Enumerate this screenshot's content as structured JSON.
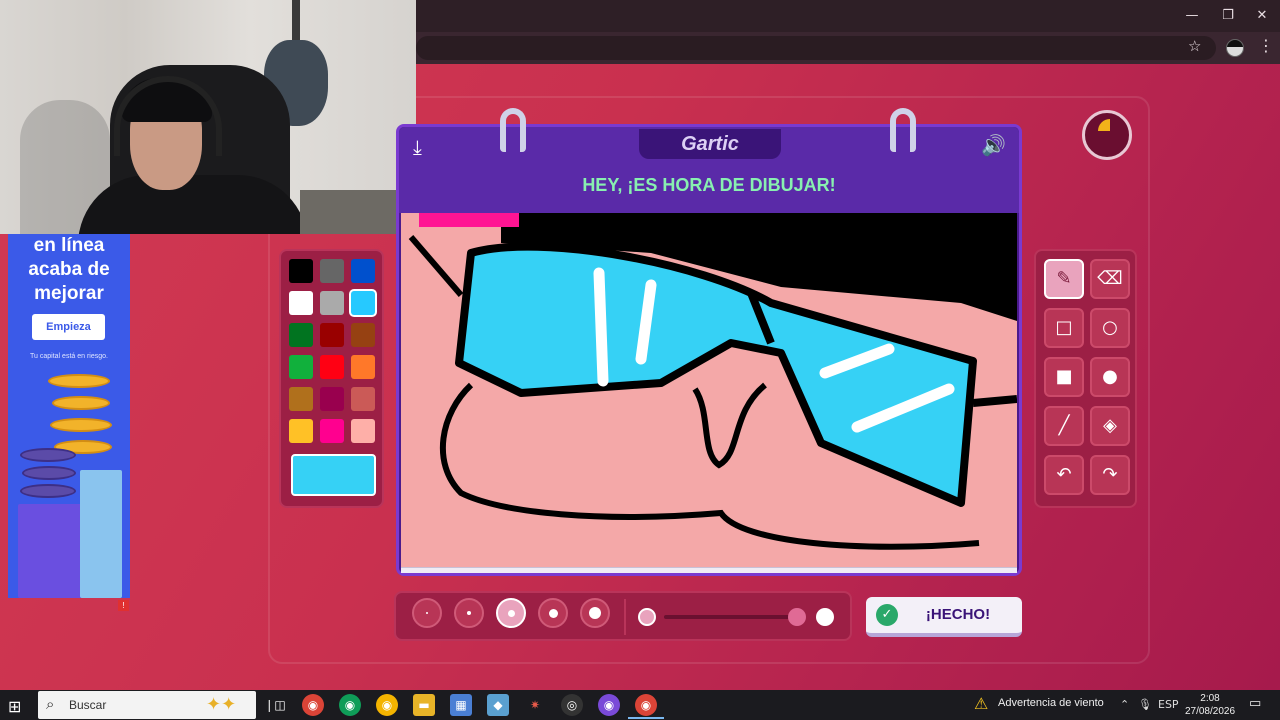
{
  "browser": {
    "window_controls": {
      "minimize": "—",
      "restore": "❐",
      "close": "✕"
    },
    "star_icon": "☆",
    "menu_icon": "⋮"
  },
  "ad": {
    "title_lines": [
      "en línea",
      "acaba de",
      "mejorar"
    ],
    "cta": "Empieza",
    "note": "Tu capital está en riesgo."
  },
  "game": {
    "logo": "Gartic",
    "prompt": "HEY, ¡ES HORA DE DIBUJAR!",
    "done_label": "¡HECHO!",
    "selected_color": "#36d1f5",
    "timer_elapsed_fraction": 0.12,
    "palette": [
      "#000000",
      "#666666",
      "#0050cd",
      "#ffffff",
      "#aaaaaa",
      "#26c9ff",
      "#017420",
      "#990000",
      "#964112",
      "#11b03c",
      "#ff0013",
      "#ff7829",
      "#b0701c",
      "#99004e",
      "#cb5a57",
      "#ffc126",
      "#ff008f",
      "#feafa8"
    ],
    "tools": [
      "pencil",
      "eraser",
      "rectangle-outline",
      "ellipse-outline",
      "rectangle-filled",
      "ellipse-filled",
      "line",
      "fill-bucket",
      "undo",
      "redo"
    ],
    "brush_sizes": 5,
    "active_brush_size_index": 2
  },
  "taskbar": {
    "search_placeholder": "Buscar",
    "weather": "Advertencia de viento",
    "language": "ESP",
    "time": "2:08",
    "date": "27/08/2026"
  }
}
